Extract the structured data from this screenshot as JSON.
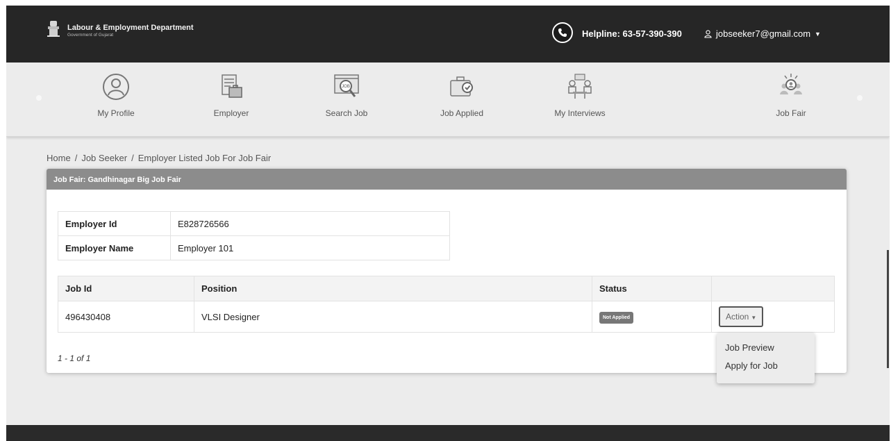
{
  "header": {
    "org_name": "Labour & Employment Department",
    "org_sub": "Government of Gujarat",
    "helpline": "Helpline: 63-57-390-390",
    "user_email": "jobseeker7@gmail.com"
  },
  "nav": {
    "items": [
      {
        "label": "My Profile",
        "icon": "user-icon"
      },
      {
        "label": "Employer",
        "icon": "employer-icon"
      },
      {
        "label": "Search Job",
        "icon": "search-job-icon"
      },
      {
        "label": "Job Applied",
        "icon": "briefcase-icon"
      },
      {
        "label": "My Interviews",
        "icon": "interview-icon"
      },
      {
        "label": "Job Fair",
        "icon": "job-fair-icon"
      }
    ]
  },
  "breadcrumb": {
    "home": "Home",
    "level1": "Job Seeker",
    "current": "Employer Listed Job For Job Fair",
    "separator": "/"
  },
  "card": {
    "title": "Job Fair: Gandhinagar Big Job Fair"
  },
  "employer": {
    "id_label": "Employer Id",
    "id_value": "E828726566",
    "name_label": "Employer Name",
    "name_value": "Employer 101"
  },
  "jobs": {
    "columns": [
      "Job Id",
      "Position",
      "Status",
      ""
    ],
    "rows": [
      {
        "job_id": "496430408",
        "position": "VLSI Designer",
        "status": "Not Applied",
        "action": "Action"
      }
    ],
    "pager": "1 - 1 of 1"
  },
  "action_menu": {
    "items": [
      "Job Preview",
      "Apply for Job"
    ]
  },
  "colors": {
    "topbar": "#262626",
    "card_header": "#8c8c8c",
    "badge": "#777777",
    "background": "#ececec"
  }
}
